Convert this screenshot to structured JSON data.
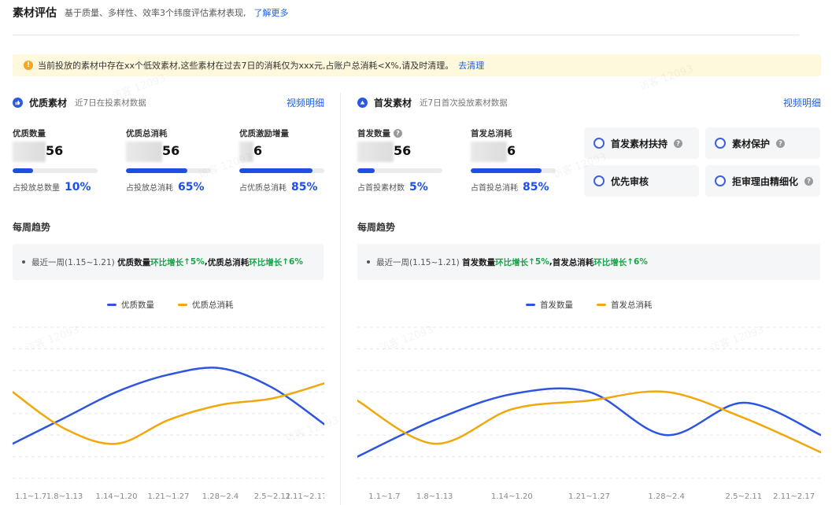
{
  "header": {
    "title": "素材评估",
    "subtitle": "基于质量、多样性、效率3个纬度评估素材表现,",
    "link": "了解更多"
  },
  "warning": {
    "icon": "!",
    "text": "当前投放的素材中存在xx个低效素材,这些素材在过去7日的消耗仅为xxx元,占账户总消耗<X%,请及时清理。",
    "link": "去清理"
  },
  "left": {
    "title": "优质素材",
    "subtitle": "近7日在投素材数据",
    "link": "视频明细",
    "metrics": [
      {
        "label": "优质数量",
        "value": "56",
        "foot_label": "占投放总数量",
        "foot_value": "10%",
        "progress": 0.24
      },
      {
        "label": "优质总消耗",
        "value": "56",
        "foot_label": "占投放总消耗",
        "foot_value": "65%",
        "progress": 0.72
      },
      {
        "label": "优质激励增量",
        "value": "6",
        "foot_label": "占优质总消耗",
        "foot_value": "85%",
        "progress": 0.86
      }
    ],
    "trend_title": "每周趋势",
    "summary": {
      "prefix": "最近一周(1.15~1.21)",
      "m1": "优质数量",
      "c1": "环比增长",
      "v1": "5%",
      "sep": ",",
      "m2": "优质总消耗",
      "c2": "环比增长",
      "v2": "6%"
    },
    "legend": [
      "优质数量",
      "优质总消耗"
    ]
  },
  "right": {
    "title": "首发素材",
    "subtitle": "近7日首次投放素材数据",
    "link": "视频明细",
    "metrics": [
      {
        "label": "首发数量",
        "value": "56",
        "foot_label": "占首投素材数",
        "foot_value": "5%",
        "progress": 0.2
      },
      {
        "label": "首发总消耗",
        "value": "6",
        "foot_label": "占首投总消耗",
        "foot_value": "85%",
        "progress": 0.83
      }
    ],
    "features": [
      "首发素材扶持",
      "素材保护",
      "优先审核",
      "拒审理由精细化"
    ],
    "trend_title": "每周趋势",
    "summary": {
      "prefix": "最近一周(1.15~1.21)",
      "m1": "首发数量",
      "c1": "环比增长",
      "v1": "5%",
      "sep": ",",
      "m2": "首发总消耗",
      "c2": "环比增长",
      "v2": "6%"
    },
    "legend": [
      "首发数量",
      "首发总消耗"
    ]
  },
  "chart_data": [
    {
      "type": "line",
      "categories": [
        "1.1~1.7",
        "1.8~1.13",
        "1.14~1.20",
        "1.21~1.27",
        "1.28~2.4",
        "2.5~2.11",
        "2.11~2.17"
      ],
      "series": [
        {
          "name": "优质数量",
          "values": [
            1.6,
            2.8,
            4.0,
            4.8,
            5.1,
            4.2,
            2.5
          ]
        },
        {
          "name": "优质总消耗",
          "values": [
            4.0,
            2.3,
            1.6,
            2.7,
            3.4,
            3.7,
            4.4
          ]
        }
      ],
      "colors": [
        "#2e55e0",
        "#f0a80c"
      ],
      "ylim": [
        0,
        7
      ],
      "grid": true
    },
    {
      "type": "line",
      "categories": [
        "1.1~1.7",
        "1.8~1.13",
        "1.14~1.20",
        "1.21~1.27",
        "1.28~2.4",
        "2.5~2.11",
        "2.11~2.17"
      ],
      "series": [
        {
          "name": "首发数量",
          "values": [
            1.0,
            2.7,
            3.9,
            4.0,
            2.0,
            3.5,
            2.0
          ]
        },
        {
          "name": "首发总消耗",
          "values": [
            3.6,
            1.6,
            3.2,
            3.6,
            4.0,
            2.8,
            1.2
          ]
        }
      ],
      "colors": [
        "#2e55e0",
        "#f0a80c"
      ],
      "ylim": [
        0,
        7
      ],
      "grid": true
    }
  ],
  "colors": {
    "accent": "#1f4fe0",
    "up": "#1aa34a",
    "warning_bg": "#fef8dd"
  }
}
